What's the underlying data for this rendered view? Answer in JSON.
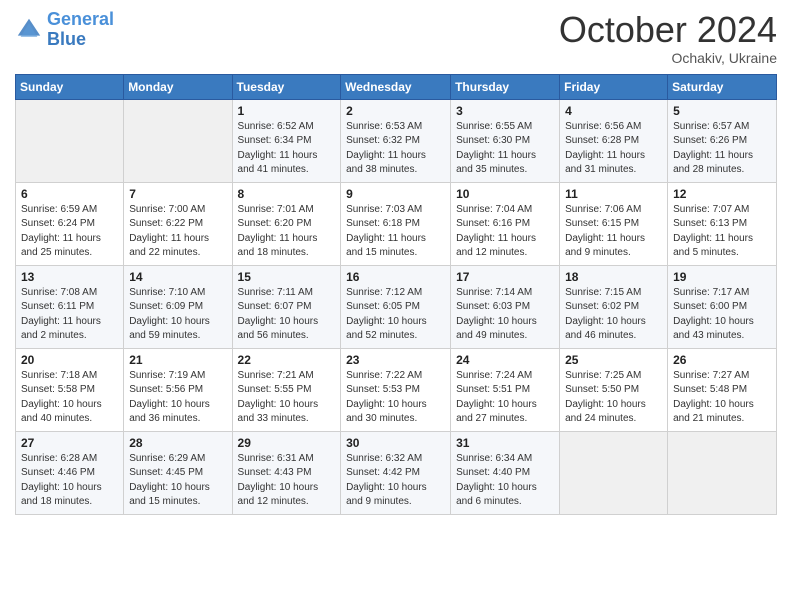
{
  "header": {
    "logo_line1": "General",
    "logo_line2": "Blue",
    "month": "October 2024",
    "location": "Ochakiv, Ukraine"
  },
  "weekdays": [
    "Sunday",
    "Monday",
    "Tuesday",
    "Wednesday",
    "Thursday",
    "Friday",
    "Saturday"
  ],
  "weeks": [
    [
      {
        "day": "",
        "detail": ""
      },
      {
        "day": "",
        "detail": ""
      },
      {
        "day": "1",
        "detail": "Sunrise: 6:52 AM\nSunset: 6:34 PM\nDaylight: 11 hours and 41 minutes."
      },
      {
        "day": "2",
        "detail": "Sunrise: 6:53 AM\nSunset: 6:32 PM\nDaylight: 11 hours and 38 minutes."
      },
      {
        "day": "3",
        "detail": "Sunrise: 6:55 AM\nSunset: 6:30 PM\nDaylight: 11 hours and 35 minutes."
      },
      {
        "day": "4",
        "detail": "Sunrise: 6:56 AM\nSunset: 6:28 PM\nDaylight: 11 hours and 31 minutes."
      },
      {
        "day": "5",
        "detail": "Sunrise: 6:57 AM\nSunset: 6:26 PM\nDaylight: 11 hours and 28 minutes."
      }
    ],
    [
      {
        "day": "6",
        "detail": "Sunrise: 6:59 AM\nSunset: 6:24 PM\nDaylight: 11 hours and 25 minutes."
      },
      {
        "day": "7",
        "detail": "Sunrise: 7:00 AM\nSunset: 6:22 PM\nDaylight: 11 hours and 22 minutes."
      },
      {
        "day": "8",
        "detail": "Sunrise: 7:01 AM\nSunset: 6:20 PM\nDaylight: 11 hours and 18 minutes."
      },
      {
        "day": "9",
        "detail": "Sunrise: 7:03 AM\nSunset: 6:18 PM\nDaylight: 11 hours and 15 minutes."
      },
      {
        "day": "10",
        "detail": "Sunrise: 7:04 AM\nSunset: 6:16 PM\nDaylight: 11 hours and 12 minutes."
      },
      {
        "day": "11",
        "detail": "Sunrise: 7:06 AM\nSunset: 6:15 PM\nDaylight: 11 hours and 9 minutes."
      },
      {
        "day": "12",
        "detail": "Sunrise: 7:07 AM\nSunset: 6:13 PM\nDaylight: 11 hours and 5 minutes."
      }
    ],
    [
      {
        "day": "13",
        "detail": "Sunrise: 7:08 AM\nSunset: 6:11 PM\nDaylight: 11 hours and 2 minutes."
      },
      {
        "day": "14",
        "detail": "Sunrise: 7:10 AM\nSunset: 6:09 PM\nDaylight: 10 hours and 59 minutes."
      },
      {
        "day": "15",
        "detail": "Sunrise: 7:11 AM\nSunset: 6:07 PM\nDaylight: 10 hours and 56 minutes."
      },
      {
        "day": "16",
        "detail": "Sunrise: 7:12 AM\nSunset: 6:05 PM\nDaylight: 10 hours and 52 minutes."
      },
      {
        "day": "17",
        "detail": "Sunrise: 7:14 AM\nSunset: 6:03 PM\nDaylight: 10 hours and 49 minutes."
      },
      {
        "day": "18",
        "detail": "Sunrise: 7:15 AM\nSunset: 6:02 PM\nDaylight: 10 hours and 46 minutes."
      },
      {
        "day": "19",
        "detail": "Sunrise: 7:17 AM\nSunset: 6:00 PM\nDaylight: 10 hours and 43 minutes."
      }
    ],
    [
      {
        "day": "20",
        "detail": "Sunrise: 7:18 AM\nSunset: 5:58 PM\nDaylight: 10 hours and 40 minutes."
      },
      {
        "day": "21",
        "detail": "Sunrise: 7:19 AM\nSunset: 5:56 PM\nDaylight: 10 hours and 36 minutes."
      },
      {
        "day": "22",
        "detail": "Sunrise: 7:21 AM\nSunset: 5:55 PM\nDaylight: 10 hours and 33 minutes."
      },
      {
        "day": "23",
        "detail": "Sunrise: 7:22 AM\nSunset: 5:53 PM\nDaylight: 10 hours and 30 minutes."
      },
      {
        "day": "24",
        "detail": "Sunrise: 7:24 AM\nSunset: 5:51 PM\nDaylight: 10 hours and 27 minutes."
      },
      {
        "day": "25",
        "detail": "Sunrise: 7:25 AM\nSunset: 5:50 PM\nDaylight: 10 hours and 24 minutes."
      },
      {
        "day": "26",
        "detail": "Sunrise: 7:27 AM\nSunset: 5:48 PM\nDaylight: 10 hours and 21 minutes."
      }
    ],
    [
      {
        "day": "27",
        "detail": "Sunrise: 6:28 AM\nSunset: 4:46 PM\nDaylight: 10 hours and 18 minutes."
      },
      {
        "day": "28",
        "detail": "Sunrise: 6:29 AM\nSunset: 4:45 PM\nDaylight: 10 hours and 15 minutes."
      },
      {
        "day": "29",
        "detail": "Sunrise: 6:31 AM\nSunset: 4:43 PM\nDaylight: 10 hours and 12 minutes."
      },
      {
        "day": "30",
        "detail": "Sunrise: 6:32 AM\nSunset: 4:42 PM\nDaylight: 10 hours and 9 minutes."
      },
      {
        "day": "31",
        "detail": "Sunrise: 6:34 AM\nSunset: 4:40 PM\nDaylight: 10 hours and 6 minutes."
      },
      {
        "day": "",
        "detail": ""
      },
      {
        "day": "",
        "detail": ""
      }
    ]
  ]
}
